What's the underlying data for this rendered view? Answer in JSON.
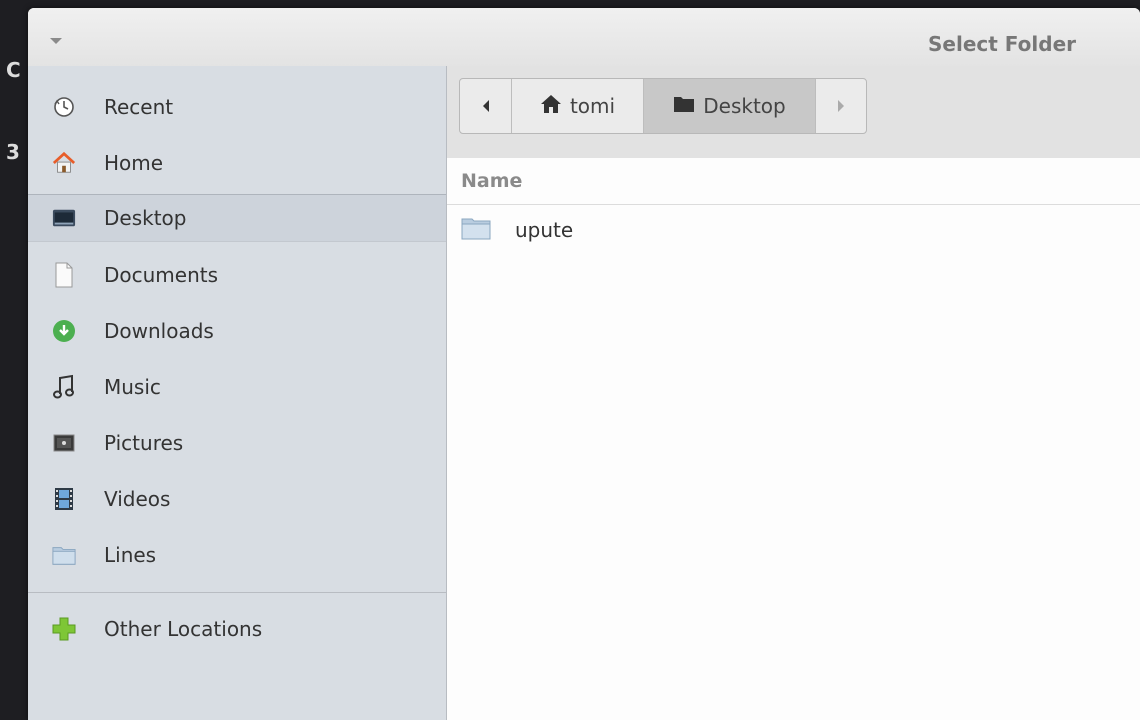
{
  "window": {
    "title": "Select Folder"
  },
  "background": {
    "letters": [
      "C",
      "3"
    ]
  },
  "sidebar": {
    "items": [
      {
        "label": "Recent",
        "icon": "clock-icon"
      },
      {
        "label": "Home",
        "icon": "home-icon"
      },
      {
        "label": "Desktop",
        "icon": "desktop-icon",
        "selected": true
      },
      {
        "label": "Documents",
        "icon": "document-icon"
      },
      {
        "label": "Downloads",
        "icon": "download-icon"
      },
      {
        "label": "Music",
        "icon": "music-note-icon"
      },
      {
        "label": "Pictures",
        "icon": "pictures-icon"
      },
      {
        "label": "Videos",
        "icon": "videos-icon"
      },
      {
        "label": "Lines",
        "icon": "folder-icon"
      }
    ],
    "other_locations": {
      "label": "Other Locations",
      "icon": "plus-icon"
    }
  },
  "pathbar": {
    "segments": [
      {
        "label": "tomi",
        "icon": "home-icon"
      },
      {
        "label": "Desktop",
        "icon": "folder-icon",
        "active": true
      }
    ]
  },
  "file_list": {
    "column_name": "Name",
    "items": [
      {
        "label": "upute",
        "icon": "folder-icon"
      }
    ]
  },
  "colors": {
    "sidebar_bg": "#d8dde3",
    "title_text": "#777777",
    "download_green": "#4caf50",
    "plus_green": "#7ec636",
    "home_roof": "#e85d2a"
  }
}
